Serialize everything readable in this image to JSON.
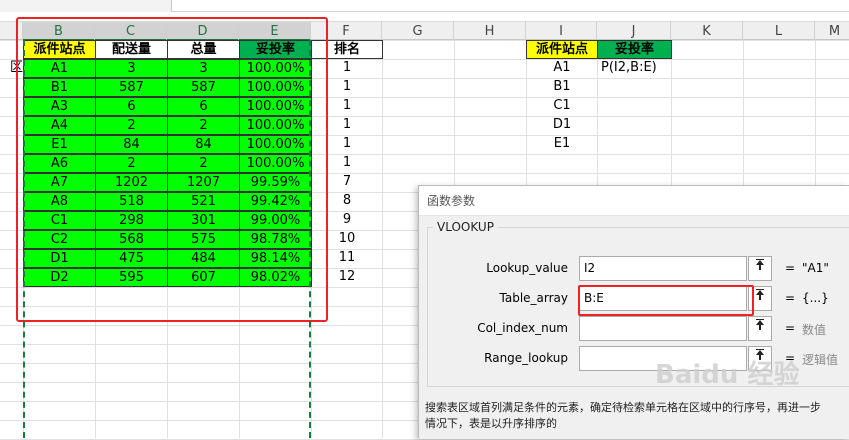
{
  "columns": [
    {
      "label": "B",
      "selected": true
    },
    {
      "label": "C",
      "selected": true
    },
    {
      "label": "D",
      "selected": true
    },
    {
      "label": "E",
      "selected": true
    },
    {
      "label": "F",
      "selected": false
    },
    {
      "label": "G",
      "selected": false
    },
    {
      "label": "H",
      "selected": false
    },
    {
      "label": "I",
      "selected": false
    },
    {
      "label": "J",
      "selected": false
    },
    {
      "label": "K",
      "selected": false
    },
    {
      "label": "L",
      "selected": false
    },
    {
      "label": "M",
      "selected": false
    }
  ],
  "main_table": {
    "headers": [
      "派件站点",
      "配送量",
      "总量",
      "妥投率",
      "排名"
    ],
    "col_a_label": "区",
    "rows": [
      [
        "A1",
        "3",
        "3",
        "100.00%",
        "1"
      ],
      [
        "B1",
        "587",
        "587",
        "100.00%",
        "1"
      ],
      [
        "A3",
        "6",
        "6",
        "100.00%",
        "1"
      ],
      [
        "A4",
        "2",
        "2",
        "100.00%",
        "1"
      ],
      [
        "E1",
        "84",
        "84",
        "100.00%",
        "1"
      ],
      [
        "A6",
        "2",
        "2",
        "100.00%",
        "1"
      ],
      [
        "A7",
        "1202",
        "1207",
        "99.59%",
        "7"
      ],
      [
        "A8",
        "518",
        "521",
        "99.42%",
        "8"
      ],
      [
        "C1",
        "298",
        "301",
        "99.00%",
        "9"
      ],
      [
        "C2",
        "568",
        "575",
        "98.78%",
        "10"
      ],
      [
        "D1",
        "475",
        "484",
        "98.14%",
        "11"
      ],
      [
        "D2",
        "595",
        "607",
        "98.02%",
        "12"
      ]
    ]
  },
  "lookup_table": {
    "headers": [
      "派件站点",
      "妥投率"
    ],
    "rows": [
      [
        "A1",
        "P(I2,B:E)"
      ],
      [
        "B1",
        ""
      ],
      [
        "C1",
        ""
      ],
      [
        "D1",
        ""
      ],
      [
        "E1",
        ""
      ]
    ]
  },
  "dialog": {
    "title": "函数参数",
    "function_name": "VLOOKUP",
    "args": [
      {
        "label": "Lookup_value",
        "value": "I2",
        "result": "\"A1\"",
        "result_gray": false
      },
      {
        "label": "Table_array",
        "value": "B:E",
        "result": "{...}",
        "result_gray": false
      },
      {
        "label": "Col_index_num",
        "value": "",
        "result": "数值",
        "result_gray": true
      },
      {
        "label": "Range_lookup",
        "value": "",
        "result": "逻辑值",
        "result_gray": true
      }
    ],
    "equals": "=",
    "ref_button_icon": "collapse-dialog-icon",
    "description_line1": "搜索表区域首列满足条件的元素，确定待检索单元格在区域中的行序号，再进一步",
    "description_line2": "情况下，表是以升序排序的"
  },
  "watermark": "Baidu 经验",
  "colors": {
    "green": "#00ff00",
    "yellow": "#ffff00",
    "dark_green": "#00b050",
    "highlight_red": "#ee2222",
    "marching_ants": "#1b7a3c"
  }
}
